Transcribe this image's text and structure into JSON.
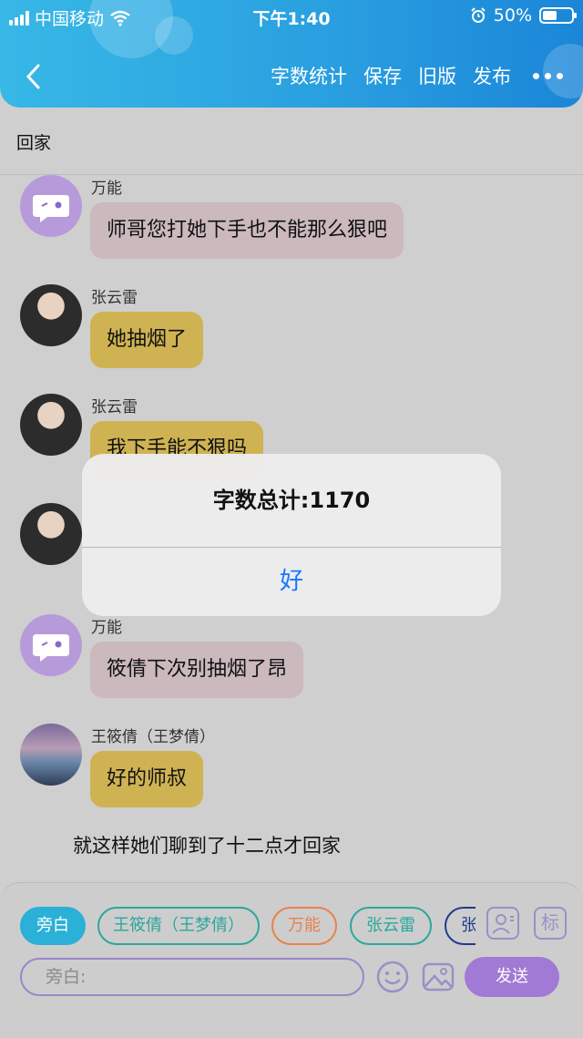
{
  "status": {
    "carrier": "中国移动",
    "time": "下午1:40",
    "battery": "50%",
    "battery_level": 0.5
  },
  "nav": {
    "actions": [
      "字数统计",
      "保存",
      "旧版",
      "发布"
    ]
  },
  "chat": {
    "title": "回家",
    "messages": [
      {
        "sender": "万能",
        "text": "师哥您打她下手也不能那么狠吧"
      },
      {
        "sender": "张云雷",
        "text": "她抽烟了"
      },
      {
        "sender": "张云雷",
        "text": "我下手能不狠吗"
      },
      {
        "sender": "万能",
        "text": "筱倩下次别抽烟了昂"
      },
      {
        "sender": "王筱倩（王梦倩）",
        "text": "好的师叔"
      }
    ],
    "narration": "就这样她们聊到了十二点才回家"
  },
  "dialog": {
    "message": "字数总计:1170",
    "ok": "好"
  },
  "composer": {
    "chips": [
      "旁白",
      "王筱倩（王梦倩）",
      "万能",
      "张云雷",
      "张云雷"
    ],
    "chip_colors": [
      "#2bb0d8",
      "#2aa89c",
      "#e8824a",
      "#2aa89c",
      "#1f3c8c"
    ],
    "tag_label": "标",
    "placeholder": "旁白:",
    "send": "发送"
  },
  "colors": {
    "header": "#2aa0e0",
    "bubble_pink": "#cbb9bd",
    "bubble_yellow": "#cfb352",
    "dialog_button": "#1677ff",
    "send_button": "#a07ad4"
  }
}
